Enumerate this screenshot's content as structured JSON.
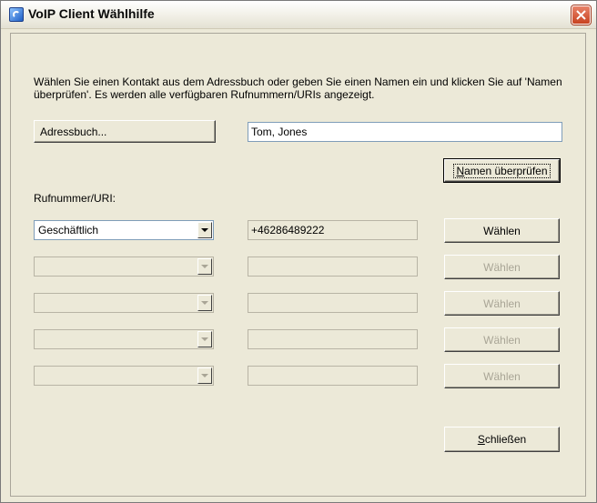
{
  "window": {
    "title": "VoIP Client Wählhilfe"
  },
  "instruction": "Wählen Sie einen Kontakt aus dem Adressbuch oder geben Sie einen Namen ein und klicken Sie auf 'Namen überprüfen'. Es werden alle verfügbaren Rufnummern/URIs angezeigt.",
  "address_book_button": "Adressbuch...",
  "name_field_value": "Tom, Jones",
  "check_names_button": {
    "accel": "N",
    "rest": "amen überprüfen"
  },
  "number_label": "Rufnummer/URI:",
  "rows": [
    {
      "type": "Geschäftlich",
      "number": "+46286489222",
      "dial_label": "Wählen",
      "enabled": true
    },
    {
      "type": "",
      "number": "",
      "dial_label": "Wählen",
      "enabled": false
    },
    {
      "type": "",
      "number": "",
      "dial_label": "Wählen",
      "enabled": false
    },
    {
      "type": "",
      "number": "",
      "dial_label": "Wählen",
      "enabled": false
    },
    {
      "type": "",
      "number": "",
      "dial_label": "Wählen",
      "enabled": false
    }
  ],
  "close_button": {
    "accel": "S",
    "rest": "chließen"
  }
}
